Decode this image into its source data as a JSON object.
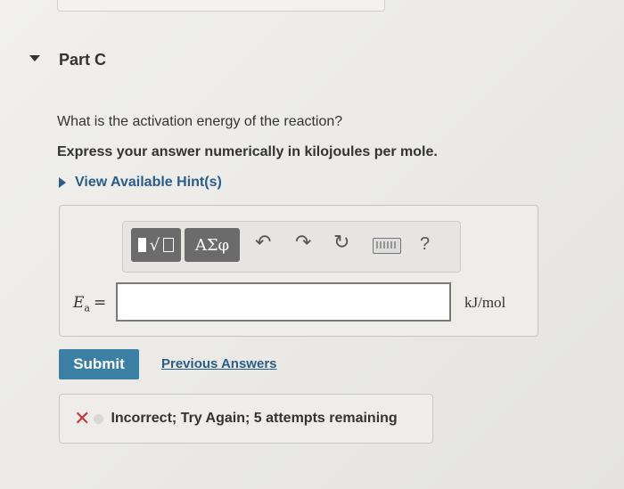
{
  "part": {
    "title": "Part C"
  },
  "question": {
    "text": "What is the activation energy of the reaction?",
    "instruction": "Express your answer numerically in kilojoules per mole."
  },
  "hints": {
    "label": "View Available Hint(s)"
  },
  "toolbar": {
    "greek_label": "ΑΣφ",
    "help_label": "?",
    "icons": [
      "templates-icon",
      "greek-symbols-icon",
      "undo-icon",
      "redo-icon",
      "reset-icon",
      "keyboard-icon",
      "help-icon"
    ]
  },
  "answer": {
    "variable": "E",
    "subscript": "a",
    "equals": "=",
    "value": "",
    "units": "kJ/mol"
  },
  "actions": {
    "submit_label": "Submit",
    "previous_answers_label": "Previous Answers"
  },
  "feedback": {
    "text": "Incorrect; Try Again; 5 attempts remaining",
    "status_color": "#c6393b"
  },
  "colors": {
    "primary": "#3b7fa5",
    "link": "#2a5d8a"
  }
}
